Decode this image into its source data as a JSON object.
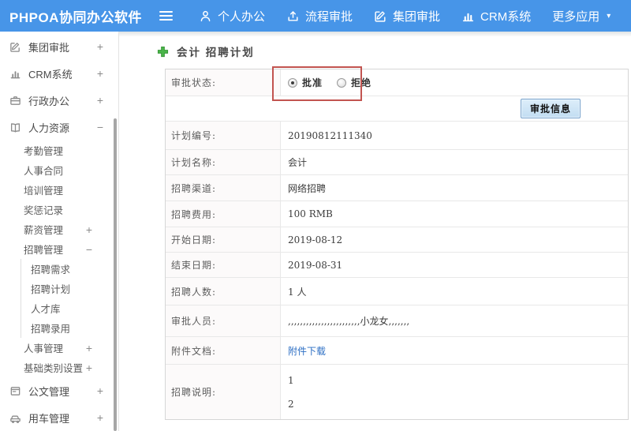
{
  "topbar": {
    "logo": "PHPOA协同办公软件",
    "menu": [
      {
        "label": "个人办公",
        "icon": "user"
      },
      {
        "label": "流程审批",
        "icon": "upload"
      },
      {
        "label": "集团审批",
        "icon": "edit-square"
      },
      {
        "label": "CRM系统",
        "icon": "bar-chart"
      },
      {
        "label": "更多应用",
        "caret": "▾"
      }
    ]
  },
  "sidebar": {
    "items": [
      {
        "label": "集团审批",
        "icon": "edit-square",
        "expand": "+",
        "level": 1
      },
      {
        "label": "CRM系统",
        "icon": "bar-chart",
        "expand": "+",
        "level": 1
      },
      {
        "label": "行政办公",
        "icon": "briefcase",
        "expand": "+",
        "level": 1
      },
      {
        "label": "人力资源",
        "icon": "book",
        "expand": "−",
        "level": 1
      },
      {
        "label": "考勤管理",
        "level": 2
      },
      {
        "label": "人事合同",
        "level": 2
      },
      {
        "label": "培训管理",
        "level": 2
      },
      {
        "label": "奖惩记录",
        "level": 2
      },
      {
        "label": "薪资管理",
        "expand": "+",
        "level": 2
      },
      {
        "label": "招聘管理",
        "expand": "−",
        "level": 2
      },
      {
        "label": "招聘需求",
        "level": 3
      },
      {
        "label": "招聘计划",
        "level": 3
      },
      {
        "label": "人才库",
        "level": 3
      },
      {
        "label": "招聘录用",
        "level": 3
      },
      {
        "label": "人事管理",
        "expand": "+",
        "level": 2
      },
      {
        "label": "基础类别设置",
        "expand": "+",
        "level": 2
      },
      {
        "label": "公文管理",
        "icon": "doc",
        "expand": "+",
        "level": 1
      },
      {
        "label": "用车管理",
        "icon": "car",
        "expand": "+",
        "level": 1
      }
    ]
  },
  "main": {
    "title": "会计 招聘计划",
    "approval_status": {
      "label": "审批状态:",
      "options": [
        {
          "label": "批准",
          "selected": true
        },
        {
          "label": "拒绝",
          "selected": false
        }
      ]
    },
    "approve_info_button": "审批信息",
    "fields": [
      {
        "label": "计划编号:",
        "value": "20190812111340"
      },
      {
        "label": "计划名称:",
        "value": "会计"
      },
      {
        "label": "招聘渠道:",
        "value": "网络招聘"
      },
      {
        "label": "招聘费用:",
        "value": "100 RMB"
      },
      {
        "label": "开始日期:",
        "value": "2019-08-12"
      },
      {
        "label": "结束日期:",
        "value": "2019-08-31"
      },
      {
        "label": "招聘人数:",
        "value": "1 人"
      },
      {
        "label": "审批人员:",
        "value": ",,,,,,,,,,,,,,,,,,,,,,,,小龙女,,,,,,,"
      },
      {
        "label": "附件文档:",
        "value": "附件下载",
        "type": "link"
      },
      {
        "label": "招聘说明:",
        "value": [
          "1",
          "2"
        ],
        "type": "multiline"
      }
    ],
    "accent_colors": {
      "topbar_blue": "#4795e8",
      "annotation_red": "#c25450",
      "link_blue": "#2d6fc4",
      "plus_green": "#4ab54a"
    }
  }
}
